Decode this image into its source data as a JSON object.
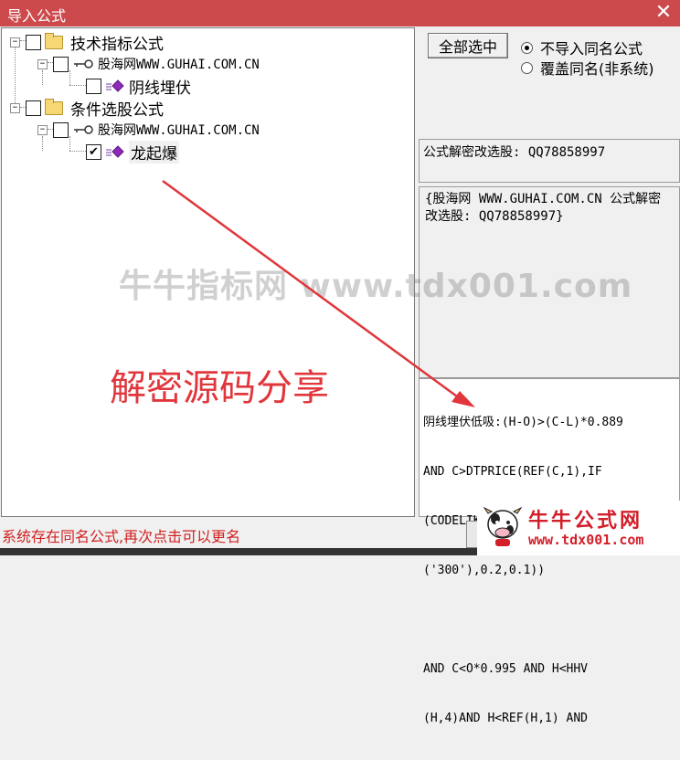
{
  "window": {
    "title": "导入公式",
    "close_glyph": "✕"
  },
  "tree": {
    "nodes": [
      {
        "label": "技术指标公式",
        "checked": false
      },
      {
        "label": "股海网WWW.GUHAI.COM.CN",
        "checked": false
      },
      {
        "label": "阴线埋伏",
        "checked": false
      },
      {
        "label": "条件选股公式",
        "checked": false
      },
      {
        "label": "股海网WWW.GUHAI.COM.CN",
        "checked": false
      },
      {
        "label": "龙起爆",
        "checked": true
      }
    ],
    "expander_glyph": "−",
    "check_glyph": "✔"
  },
  "right": {
    "select_all_label": "全部选中",
    "radio_options": [
      {
        "label": "不导入同名公式",
        "selected": true
      },
      {
        "label": "覆盖同名(非系统)",
        "selected": false
      }
    ],
    "info1": "公式解密改选股: QQ78858997",
    "info2": "{股海网 WWW.GUHAI.COM.CN 公式解密改选股: QQ78858997}",
    "code_lines": [
      "阴线埋伏低吸:(H-O)>(C-L)*0.889",
      "AND C>DTPRICE(REF(C,1),IF",
      "(CODELIKE('688') OR CODELIKE",
      "('300'),0.2,0.1))",
      "",
      "AND C<O*0.995 AND H<HHV",
      "(H,4)AND H<REF(H,1) AND"
    ]
  },
  "status": {
    "message": "系统存在同名公式,再次点击可以更名"
  },
  "overlay": {
    "watermark": "牛牛指标网 www.tdx001.com",
    "annotation": "解密源码分享",
    "logo_name": "牛牛公式网",
    "logo_url": "www.tdx001.com",
    "arrow_color": "#e0363c"
  }
}
